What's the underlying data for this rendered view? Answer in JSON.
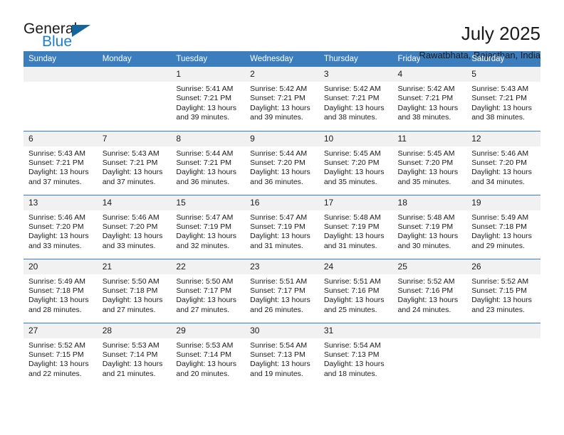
{
  "brand": {
    "name_part1": "General",
    "name_part2": "Blue",
    "triangle_color": "#14659e",
    "blue_color": "#1b7fcc"
  },
  "header": {
    "title": "July 2025",
    "subtitle": "Rawatbhata, Rajasthan, India"
  },
  "theme": {
    "header_row_bg": "#3b7dbd",
    "daynum_bg": "#f1f1f1",
    "text_color": "#1a1a1a"
  },
  "weekdays": [
    "Sunday",
    "Monday",
    "Tuesday",
    "Wednesday",
    "Thursday",
    "Friday",
    "Saturday"
  ],
  "labels": {
    "sunrise_prefix": "Sunrise:",
    "sunset_prefix": "Sunset:",
    "daylight_prefix": "Daylight:"
  },
  "weeks": [
    [
      {
        "day": ""
      },
      {
        "day": ""
      },
      {
        "day": "1",
        "sunrise": "Sunrise: 5:41 AM",
        "sunset": "Sunset: 7:21 PM",
        "daylight_l1": "Daylight: 13 hours",
        "daylight_l2": "and 39 minutes."
      },
      {
        "day": "2",
        "sunrise": "Sunrise: 5:42 AM",
        "sunset": "Sunset: 7:21 PM",
        "daylight_l1": "Daylight: 13 hours",
        "daylight_l2": "and 39 minutes."
      },
      {
        "day": "3",
        "sunrise": "Sunrise: 5:42 AM",
        "sunset": "Sunset: 7:21 PM",
        "daylight_l1": "Daylight: 13 hours",
        "daylight_l2": "and 38 minutes."
      },
      {
        "day": "4",
        "sunrise": "Sunrise: 5:42 AM",
        "sunset": "Sunset: 7:21 PM",
        "daylight_l1": "Daylight: 13 hours",
        "daylight_l2": "and 38 minutes."
      },
      {
        "day": "5",
        "sunrise": "Sunrise: 5:43 AM",
        "sunset": "Sunset: 7:21 PM",
        "daylight_l1": "Daylight: 13 hours",
        "daylight_l2": "and 38 minutes."
      }
    ],
    [
      {
        "day": "6",
        "sunrise": "Sunrise: 5:43 AM",
        "sunset": "Sunset: 7:21 PM",
        "daylight_l1": "Daylight: 13 hours",
        "daylight_l2": "and 37 minutes."
      },
      {
        "day": "7",
        "sunrise": "Sunrise: 5:43 AM",
        "sunset": "Sunset: 7:21 PM",
        "daylight_l1": "Daylight: 13 hours",
        "daylight_l2": "and 37 minutes."
      },
      {
        "day": "8",
        "sunrise": "Sunrise: 5:44 AM",
        "sunset": "Sunset: 7:21 PM",
        "daylight_l1": "Daylight: 13 hours",
        "daylight_l2": "and 36 minutes."
      },
      {
        "day": "9",
        "sunrise": "Sunrise: 5:44 AM",
        "sunset": "Sunset: 7:20 PM",
        "daylight_l1": "Daylight: 13 hours",
        "daylight_l2": "and 36 minutes."
      },
      {
        "day": "10",
        "sunrise": "Sunrise: 5:45 AM",
        "sunset": "Sunset: 7:20 PM",
        "daylight_l1": "Daylight: 13 hours",
        "daylight_l2": "and 35 minutes."
      },
      {
        "day": "11",
        "sunrise": "Sunrise: 5:45 AM",
        "sunset": "Sunset: 7:20 PM",
        "daylight_l1": "Daylight: 13 hours",
        "daylight_l2": "and 35 minutes."
      },
      {
        "day": "12",
        "sunrise": "Sunrise: 5:46 AM",
        "sunset": "Sunset: 7:20 PM",
        "daylight_l1": "Daylight: 13 hours",
        "daylight_l2": "and 34 minutes."
      }
    ],
    [
      {
        "day": "13",
        "sunrise": "Sunrise: 5:46 AM",
        "sunset": "Sunset: 7:20 PM",
        "daylight_l1": "Daylight: 13 hours",
        "daylight_l2": "and 33 minutes."
      },
      {
        "day": "14",
        "sunrise": "Sunrise: 5:46 AM",
        "sunset": "Sunset: 7:20 PM",
        "daylight_l1": "Daylight: 13 hours",
        "daylight_l2": "and 33 minutes."
      },
      {
        "day": "15",
        "sunrise": "Sunrise: 5:47 AM",
        "sunset": "Sunset: 7:19 PM",
        "daylight_l1": "Daylight: 13 hours",
        "daylight_l2": "and 32 minutes."
      },
      {
        "day": "16",
        "sunrise": "Sunrise: 5:47 AM",
        "sunset": "Sunset: 7:19 PM",
        "daylight_l1": "Daylight: 13 hours",
        "daylight_l2": "and 31 minutes."
      },
      {
        "day": "17",
        "sunrise": "Sunrise: 5:48 AM",
        "sunset": "Sunset: 7:19 PM",
        "daylight_l1": "Daylight: 13 hours",
        "daylight_l2": "and 31 minutes."
      },
      {
        "day": "18",
        "sunrise": "Sunrise: 5:48 AM",
        "sunset": "Sunset: 7:19 PM",
        "daylight_l1": "Daylight: 13 hours",
        "daylight_l2": "and 30 minutes."
      },
      {
        "day": "19",
        "sunrise": "Sunrise: 5:49 AM",
        "sunset": "Sunset: 7:18 PM",
        "daylight_l1": "Daylight: 13 hours",
        "daylight_l2": "and 29 minutes."
      }
    ],
    [
      {
        "day": "20",
        "sunrise": "Sunrise: 5:49 AM",
        "sunset": "Sunset: 7:18 PM",
        "daylight_l1": "Daylight: 13 hours",
        "daylight_l2": "and 28 minutes."
      },
      {
        "day": "21",
        "sunrise": "Sunrise: 5:50 AM",
        "sunset": "Sunset: 7:18 PM",
        "daylight_l1": "Daylight: 13 hours",
        "daylight_l2": "and 27 minutes."
      },
      {
        "day": "22",
        "sunrise": "Sunrise: 5:50 AM",
        "sunset": "Sunset: 7:17 PM",
        "daylight_l1": "Daylight: 13 hours",
        "daylight_l2": "and 27 minutes."
      },
      {
        "day": "23",
        "sunrise": "Sunrise: 5:51 AM",
        "sunset": "Sunset: 7:17 PM",
        "daylight_l1": "Daylight: 13 hours",
        "daylight_l2": "and 26 minutes."
      },
      {
        "day": "24",
        "sunrise": "Sunrise: 5:51 AM",
        "sunset": "Sunset: 7:16 PM",
        "daylight_l1": "Daylight: 13 hours",
        "daylight_l2": "and 25 minutes."
      },
      {
        "day": "25",
        "sunrise": "Sunrise: 5:52 AM",
        "sunset": "Sunset: 7:16 PM",
        "daylight_l1": "Daylight: 13 hours",
        "daylight_l2": "and 24 minutes."
      },
      {
        "day": "26",
        "sunrise": "Sunrise: 5:52 AM",
        "sunset": "Sunset: 7:15 PM",
        "daylight_l1": "Daylight: 13 hours",
        "daylight_l2": "and 23 minutes."
      }
    ],
    [
      {
        "day": "27",
        "sunrise": "Sunrise: 5:52 AM",
        "sunset": "Sunset: 7:15 PM",
        "daylight_l1": "Daylight: 13 hours",
        "daylight_l2": "and 22 minutes."
      },
      {
        "day": "28",
        "sunrise": "Sunrise: 5:53 AM",
        "sunset": "Sunset: 7:14 PM",
        "daylight_l1": "Daylight: 13 hours",
        "daylight_l2": "and 21 minutes."
      },
      {
        "day": "29",
        "sunrise": "Sunrise: 5:53 AM",
        "sunset": "Sunset: 7:14 PM",
        "daylight_l1": "Daylight: 13 hours",
        "daylight_l2": "and 20 minutes."
      },
      {
        "day": "30",
        "sunrise": "Sunrise: 5:54 AM",
        "sunset": "Sunset: 7:13 PM",
        "daylight_l1": "Daylight: 13 hours",
        "daylight_l2": "and 19 minutes."
      },
      {
        "day": "31",
        "sunrise": "Sunrise: 5:54 AM",
        "sunset": "Sunset: 7:13 PM",
        "daylight_l1": "Daylight: 13 hours",
        "daylight_l2": "and 18 minutes."
      },
      {
        "day": ""
      },
      {
        "day": ""
      }
    ]
  ]
}
